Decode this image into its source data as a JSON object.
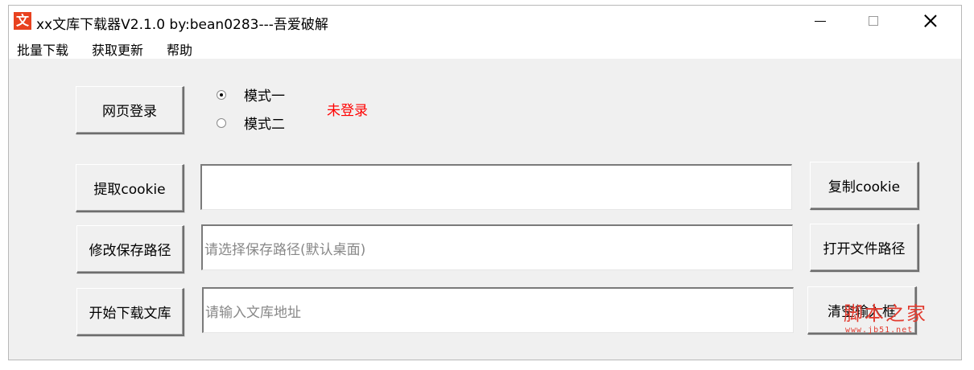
{
  "window": {
    "icon_glyph": "文",
    "title": "xx文库下载器V2.1.0  by:bean0283---吾爱破解"
  },
  "menu": [
    "批量下载",
    "获取更新",
    "帮助"
  ],
  "login": {
    "button_label": "网页登录",
    "mode1": "模式一",
    "mode2": "模式二",
    "selected_mode": "模式一",
    "status": "未登录",
    "status_color": "#ff0000"
  },
  "cookie": {
    "extract_label": "提取cookie",
    "value": "",
    "copy_label": "复制cookie"
  },
  "save_path": {
    "change_label": "修改保存路径",
    "placeholder": "请选择保存路径(默认桌面)",
    "open_label": "打开文件路径"
  },
  "download": {
    "start_label": "开始下载文库",
    "placeholder": "请输入文库地址",
    "clear_label": "清空输入框"
  },
  "watermark": {
    "text": "脚本之家",
    "sub": "www.jb51.net"
  }
}
